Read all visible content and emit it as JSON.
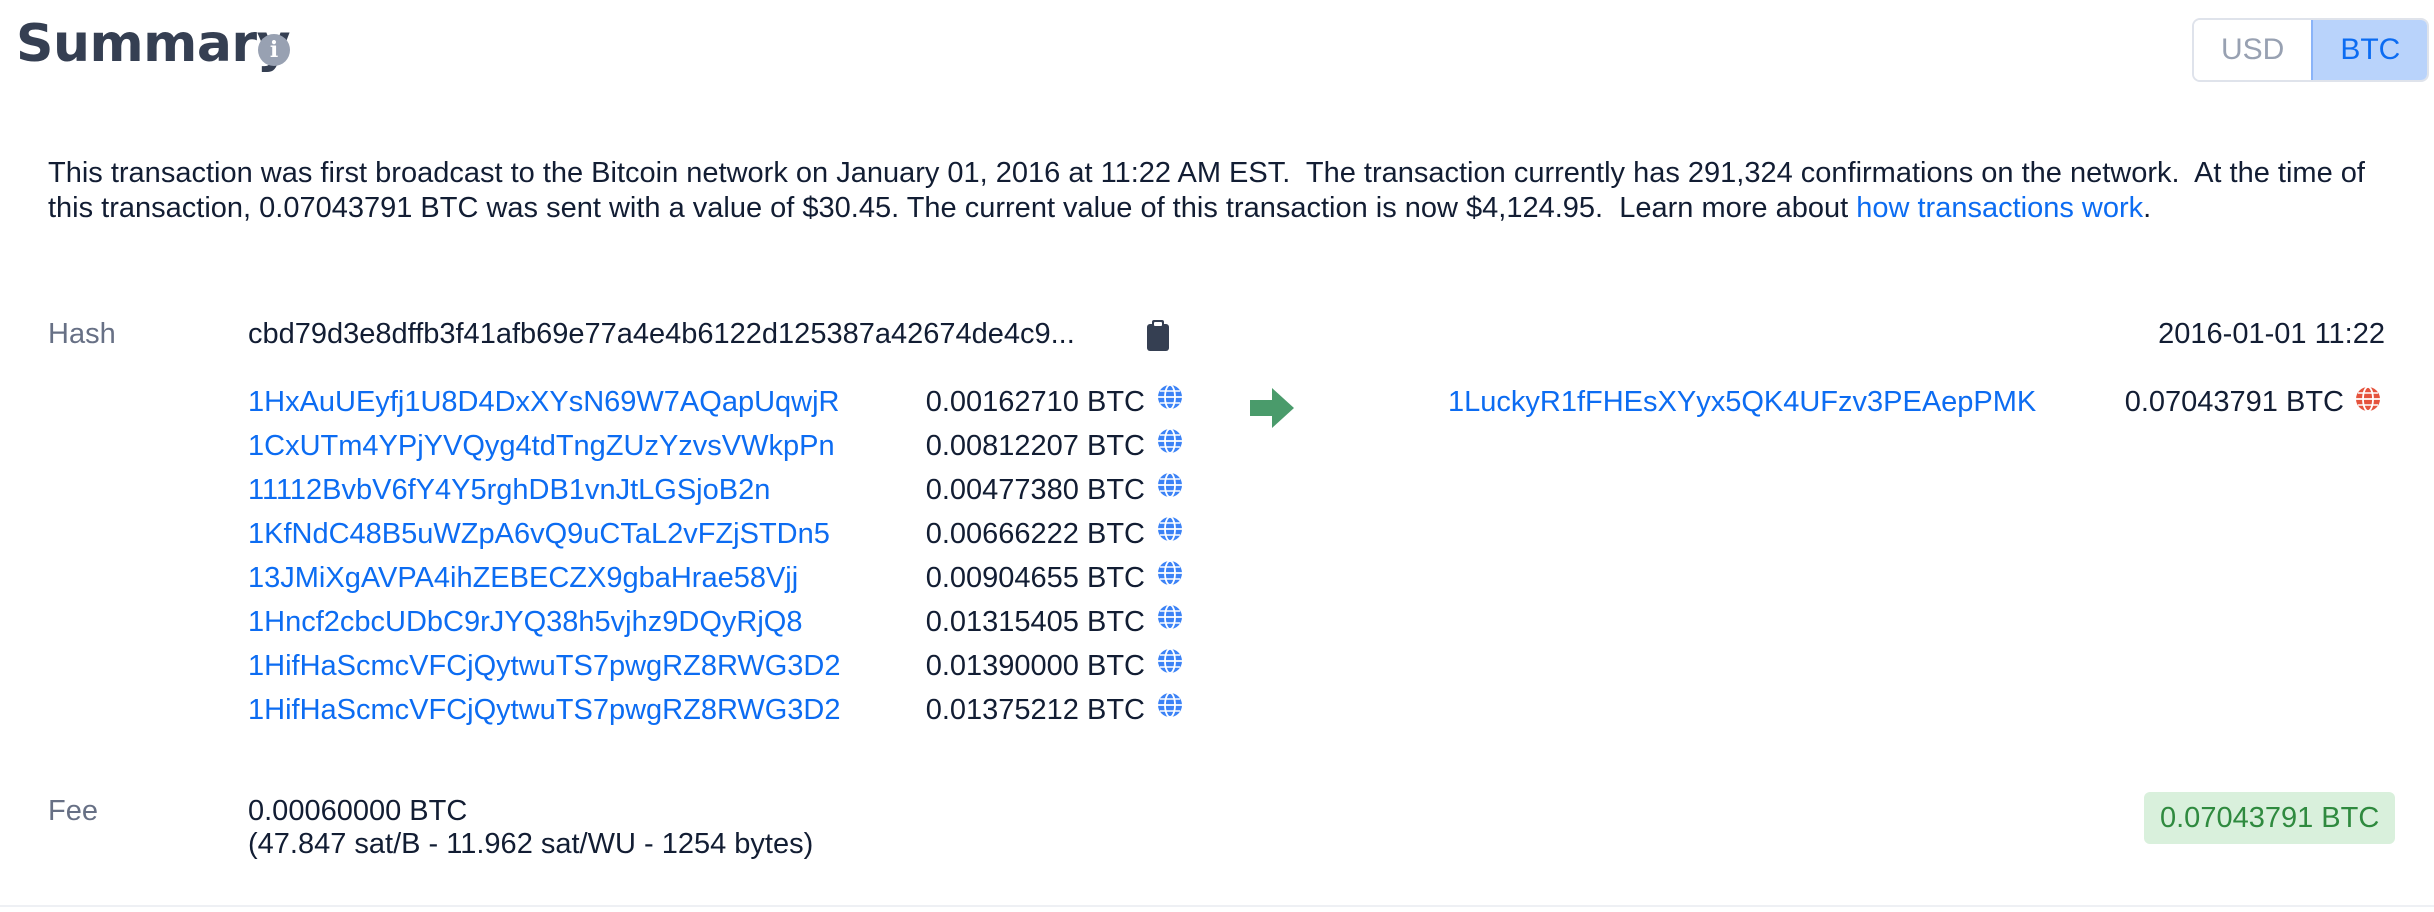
{
  "header": {
    "title": "Summary",
    "info_icon": "info-icon",
    "currency_options": [
      "USD",
      "BTC"
    ],
    "selected_currency": "BTC"
  },
  "description": {
    "text": "This transaction was first broadcast to the Bitcoin network on January 01, 2016 at 11:22 AM EST.  The transaction currently has 291,324 confirmations on the network.  At the time of this transaction, 0.07043791 BTC was sent with a value of $30.45. The current value of this transaction is now $4,124.95.  Learn more about ",
    "link_text": "how transactions work",
    "suffix": "."
  },
  "hash": {
    "label": "Hash",
    "value": "cbd79d3e8dffb3f41afb69e77a4e4b6122d125387a42674de4c9...",
    "copy_icon": "clipboard-icon",
    "timestamp": "2016-01-01 11:22"
  },
  "inputs": [
    {
      "address": "1HxAuUEyfj1U8D4DxXYsN69W7AQapUqwjR",
      "amount": "0.00162710 BTC"
    },
    {
      "address": "1CxUTm4YPjYVQyg4tdTngZUzYzvsVWkpPn",
      "amount": "0.00812207 BTC"
    },
    {
      "address": "11112BvbV6fY4Y5rghDB1vnJtLGSjoB2n",
      "amount": "0.00477380 BTC"
    },
    {
      "address": "1KfNdC48B5uWZpA6vQ9uCTaL2vFZjSTDn5",
      "amount": "0.00666222 BTC"
    },
    {
      "address": "13JMiXgAVPA4ihZEBECZX9gbaHrae58Vjj",
      "amount": "0.00904655 BTC"
    },
    {
      "address": "1Hncf2cbcUDbC9rJYQ38h5vjhz9DQyRjQ8",
      "amount": "0.01315405 BTC"
    },
    {
      "address": "1HifHaScmcVFCjQytwuTS7pwgRZ8RWG3D2",
      "amount": "0.01390000 BTC"
    },
    {
      "address": "1HifHaScmcVFCjQytwuTS7pwgRZ8RWG3D2",
      "amount": "0.01375212 BTC"
    }
  ],
  "arrow_icon": "arrow-right-icon",
  "outputs": [
    {
      "address": "1LuckyR1fFHEsXYyx5QK4UFzv3PEAepPMK",
      "amount": "0.07043791 BTC",
      "spent": true
    }
  ],
  "fee": {
    "label": "Fee",
    "value": "0.00060000 BTC",
    "detail": "(47.847 sat/B - 11.962 sat/WU - 1254 bytes)",
    "total": "0.07043791 BTC"
  },
  "colors": {
    "link": "#0c6cf2",
    "globe_unspent": "#3b82f6",
    "globe_spent": "#e5533d",
    "arrow": "#4a9b6b",
    "badge_bg": "#d9f0dc",
    "badge_text": "#2f8a3f"
  }
}
